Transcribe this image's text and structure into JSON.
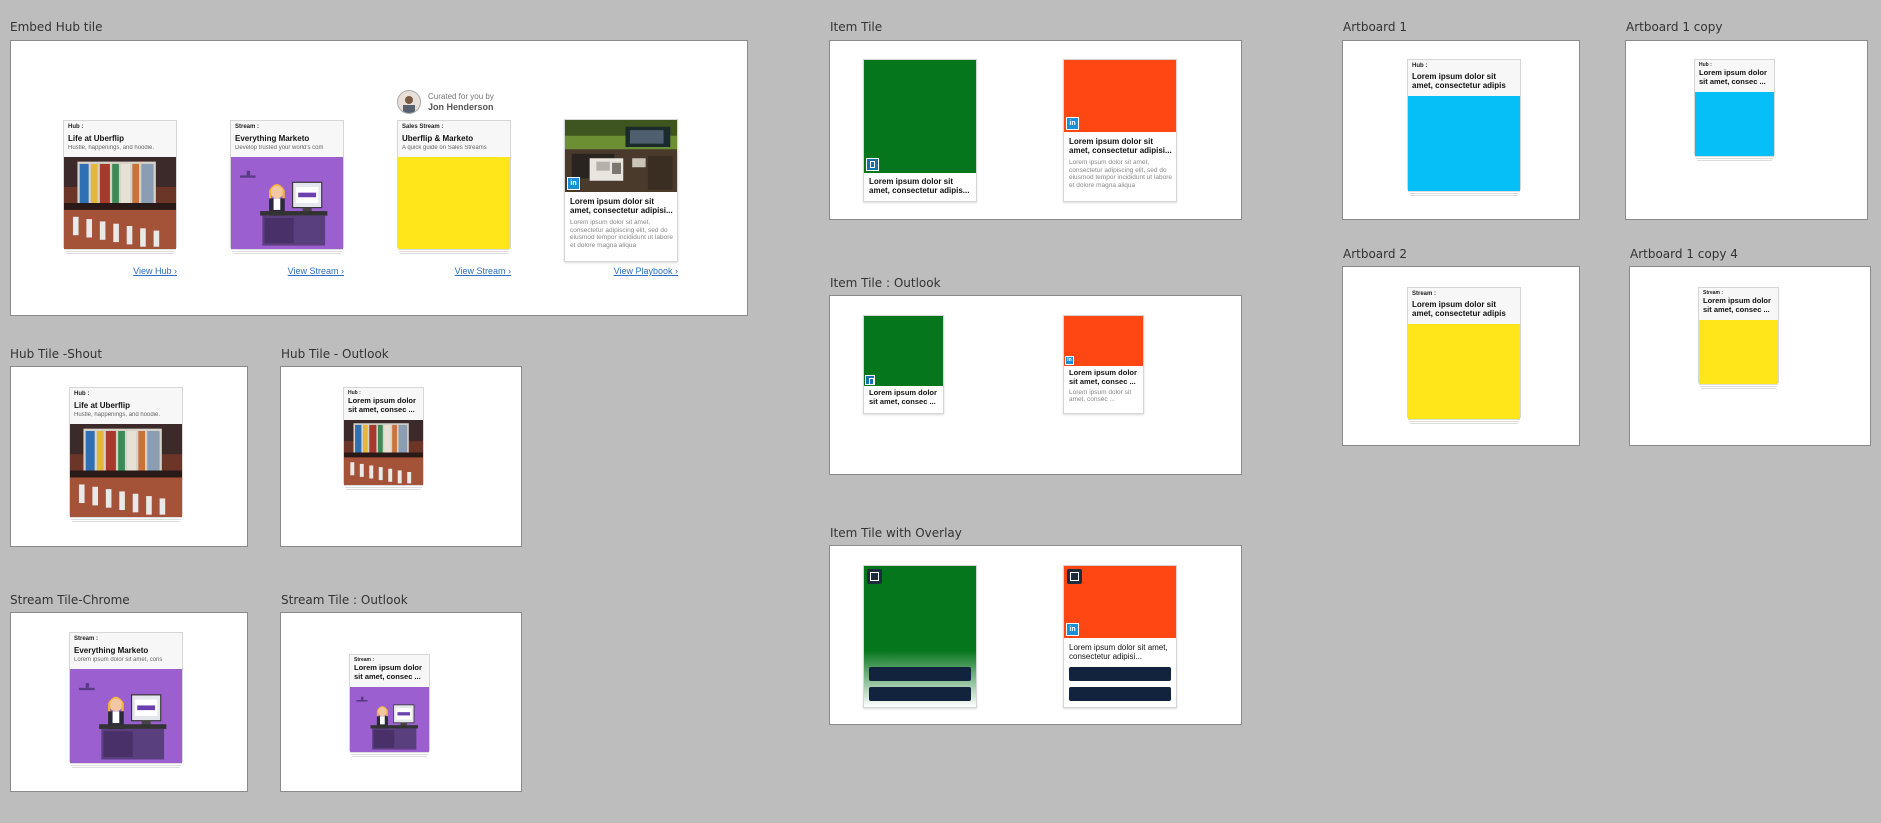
{
  "artboards": {
    "embed_hub_tile": "Embed Hub tile",
    "hub_tile_shout": "Hub Tile -Shout",
    "hub_tile_outlook": "Hub Tile - Outlook",
    "stream_tile_chrome": "Stream Tile-Chrome",
    "stream_tile_outlook": "Stream Tile : Outlook",
    "item_tile": "Item Tile",
    "item_tile_outlook": "Item Tile : Outlook",
    "item_tile_overlay": "Item Tile with Overlay",
    "artboard_1": "Artboard 1",
    "artboard_1_copy": "Artboard 1 copy",
    "artboard_2": "Artboard 2",
    "artboard_1_copy_4": "Artboard 1 copy 4"
  },
  "embed": {
    "curated_by": "Curated for you by",
    "curator_name": "Jon Henderson",
    "tiles": [
      {
        "kicker": "Hub :",
        "title": "Life at Uberflip",
        "sub": "Hustle, happenings, and hoodie.",
        "link": "View Hub ›"
      },
      {
        "kicker": "Stream :",
        "title": "Everything Marketo",
        "sub": "Develop trusted your world's com",
        "link": "View Stream ›"
      },
      {
        "kicker": "Sales Stream :",
        "title": "Uberflip & Marketo",
        "sub": "A quick guide on Sales Streams",
        "link": "View Stream ›"
      },
      {
        "title": "Lorem ipsum dolor sit amet, consectetur adipisi...",
        "desc": "Lorem ipsum dolor sit amet, consectetur adipiscing elit, sed do eiusmod tempor incididunt ut labore et dolore magna aliqua",
        "link": "View Playbook ›"
      }
    ]
  },
  "shout": {
    "kicker": "Hub :",
    "title": "Life at Uberflip",
    "sub": "Hustle, happenings, and hoodie."
  },
  "hub_outlook": {
    "kicker": "Hub :",
    "title": "Lorem ipsum dolor sit amet, consec ..."
  },
  "stream_chrome": {
    "kicker": "Stream :",
    "title": "Everything Marketo",
    "sub": "Lorem ipsum dolor sit amet, cons"
  },
  "stream_outlook": {
    "kicker": "Stream :",
    "title": "Lorem ipsum dolor sit amet, consec ..."
  },
  "item_tile": {
    "left_title": "Lorem ipsum dolor sit amet, consectetur adipis...",
    "right_title": "Lorem ipsum dolor sit amet, consectetur adipisi...",
    "right_desc": "Lorem ipsum dolor sit amet, consectetur adipiscing elit, sed do eiusmod tempor incididunt ut labore et dolore magna aliqua"
  },
  "item_outlook": {
    "left_title": "Lorem ipsum dolor sit amet, consec ...",
    "right_title": "Lorem ipsum dolor sit amet, consec ...",
    "right_desc": "Lorem ipsum dolor sit amet, consec ..."
  },
  "item_overlay": {
    "right_title": "Lorem ipsum dolor sit amet, consectetur adipisi..."
  },
  "ab1": {
    "kicker": "Hub :",
    "title": "Lorem ipsum dolor sit amet, consectetur adipis"
  },
  "ab1_copy": {
    "kicker": "Hub :",
    "title": "Lorem ipsum dolor sit amet, consec ..."
  },
  "ab2": {
    "kicker": "Stream :",
    "title": "Lorem ipsum dolor sit amet, consectetur adipis"
  },
  "ab1_copy4": {
    "kicker": "Stream :",
    "title": "Lorem ipsum dolor sit amet, consec ..."
  },
  "colors": {
    "green": "#06761d",
    "orange": "#ff4713",
    "yellow": "#ffe61b",
    "cyan": "#06bff7",
    "purple": "#9b5fcf",
    "linkedin": "#1b8fd6",
    "navy": "#12233d"
  }
}
